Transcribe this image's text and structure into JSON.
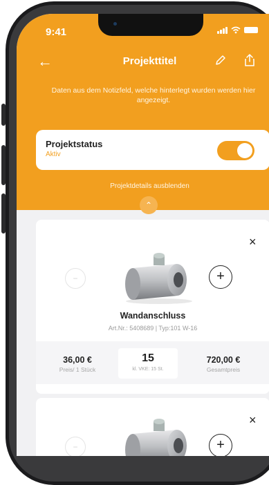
{
  "status_bar": {
    "time": "9:41"
  },
  "header": {
    "title": "Projekttitel"
  },
  "notice": "Daten aus dem Notizfeld, welche hinterlegt wurden werden hier angezeigt.",
  "project_status": {
    "label": "Projektstatus",
    "value": "Aktiv",
    "enabled": true
  },
  "toggle_details_label": "Projektdetails ausblenden",
  "products": [
    {
      "name": "Wandanschluss",
      "article": "Art.Nr.: 5408689 | Typ:101 W-16",
      "unit_price": "36,00 €",
      "unit_price_label": "Preis/ 1 Stück",
      "quantity": "15",
      "min_qty_label": "kl. VKE: 15 St.",
      "total_price": "720,00 €",
      "total_label": "Gesamtpreis"
    },
    {
      "name": "",
      "article": ""
    }
  ],
  "icons": {
    "close": "×",
    "plus": "+",
    "minus": "−",
    "back": "←",
    "collapse": "⌃"
  },
  "colors": {
    "accent": "#f29f1f",
    "background": "#f1f1f3"
  }
}
